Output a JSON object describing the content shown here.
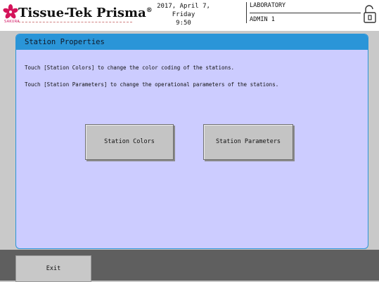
{
  "header": {
    "logo_text": "Tissue-Tek Prisma",
    "logo_trademark": "®",
    "logo_subtext": "SAKURA",
    "date": "2017, April 7, Friday",
    "time": "9:50",
    "laboratory": "LABORATORY",
    "user": "ADMIN 1",
    "lock_icon": "padlock-icon"
  },
  "panel": {
    "title": "Station Properties",
    "description_line1": "Touch [Station Colors] to change the color coding of the stations.",
    "description_line2": "Touch [Station Parameters] to change the operational parameters of the stations.",
    "station_colors_label": "Station Colors",
    "station_parameters_label": "Station Parameters"
  },
  "footer": {
    "exit_label": "Exit"
  },
  "colors": {
    "panel_bg": "#ccccff",
    "title_bar": "#2a95d8",
    "footer_bg": "#5f5f5f",
    "logo_flower": "#d4145a"
  }
}
